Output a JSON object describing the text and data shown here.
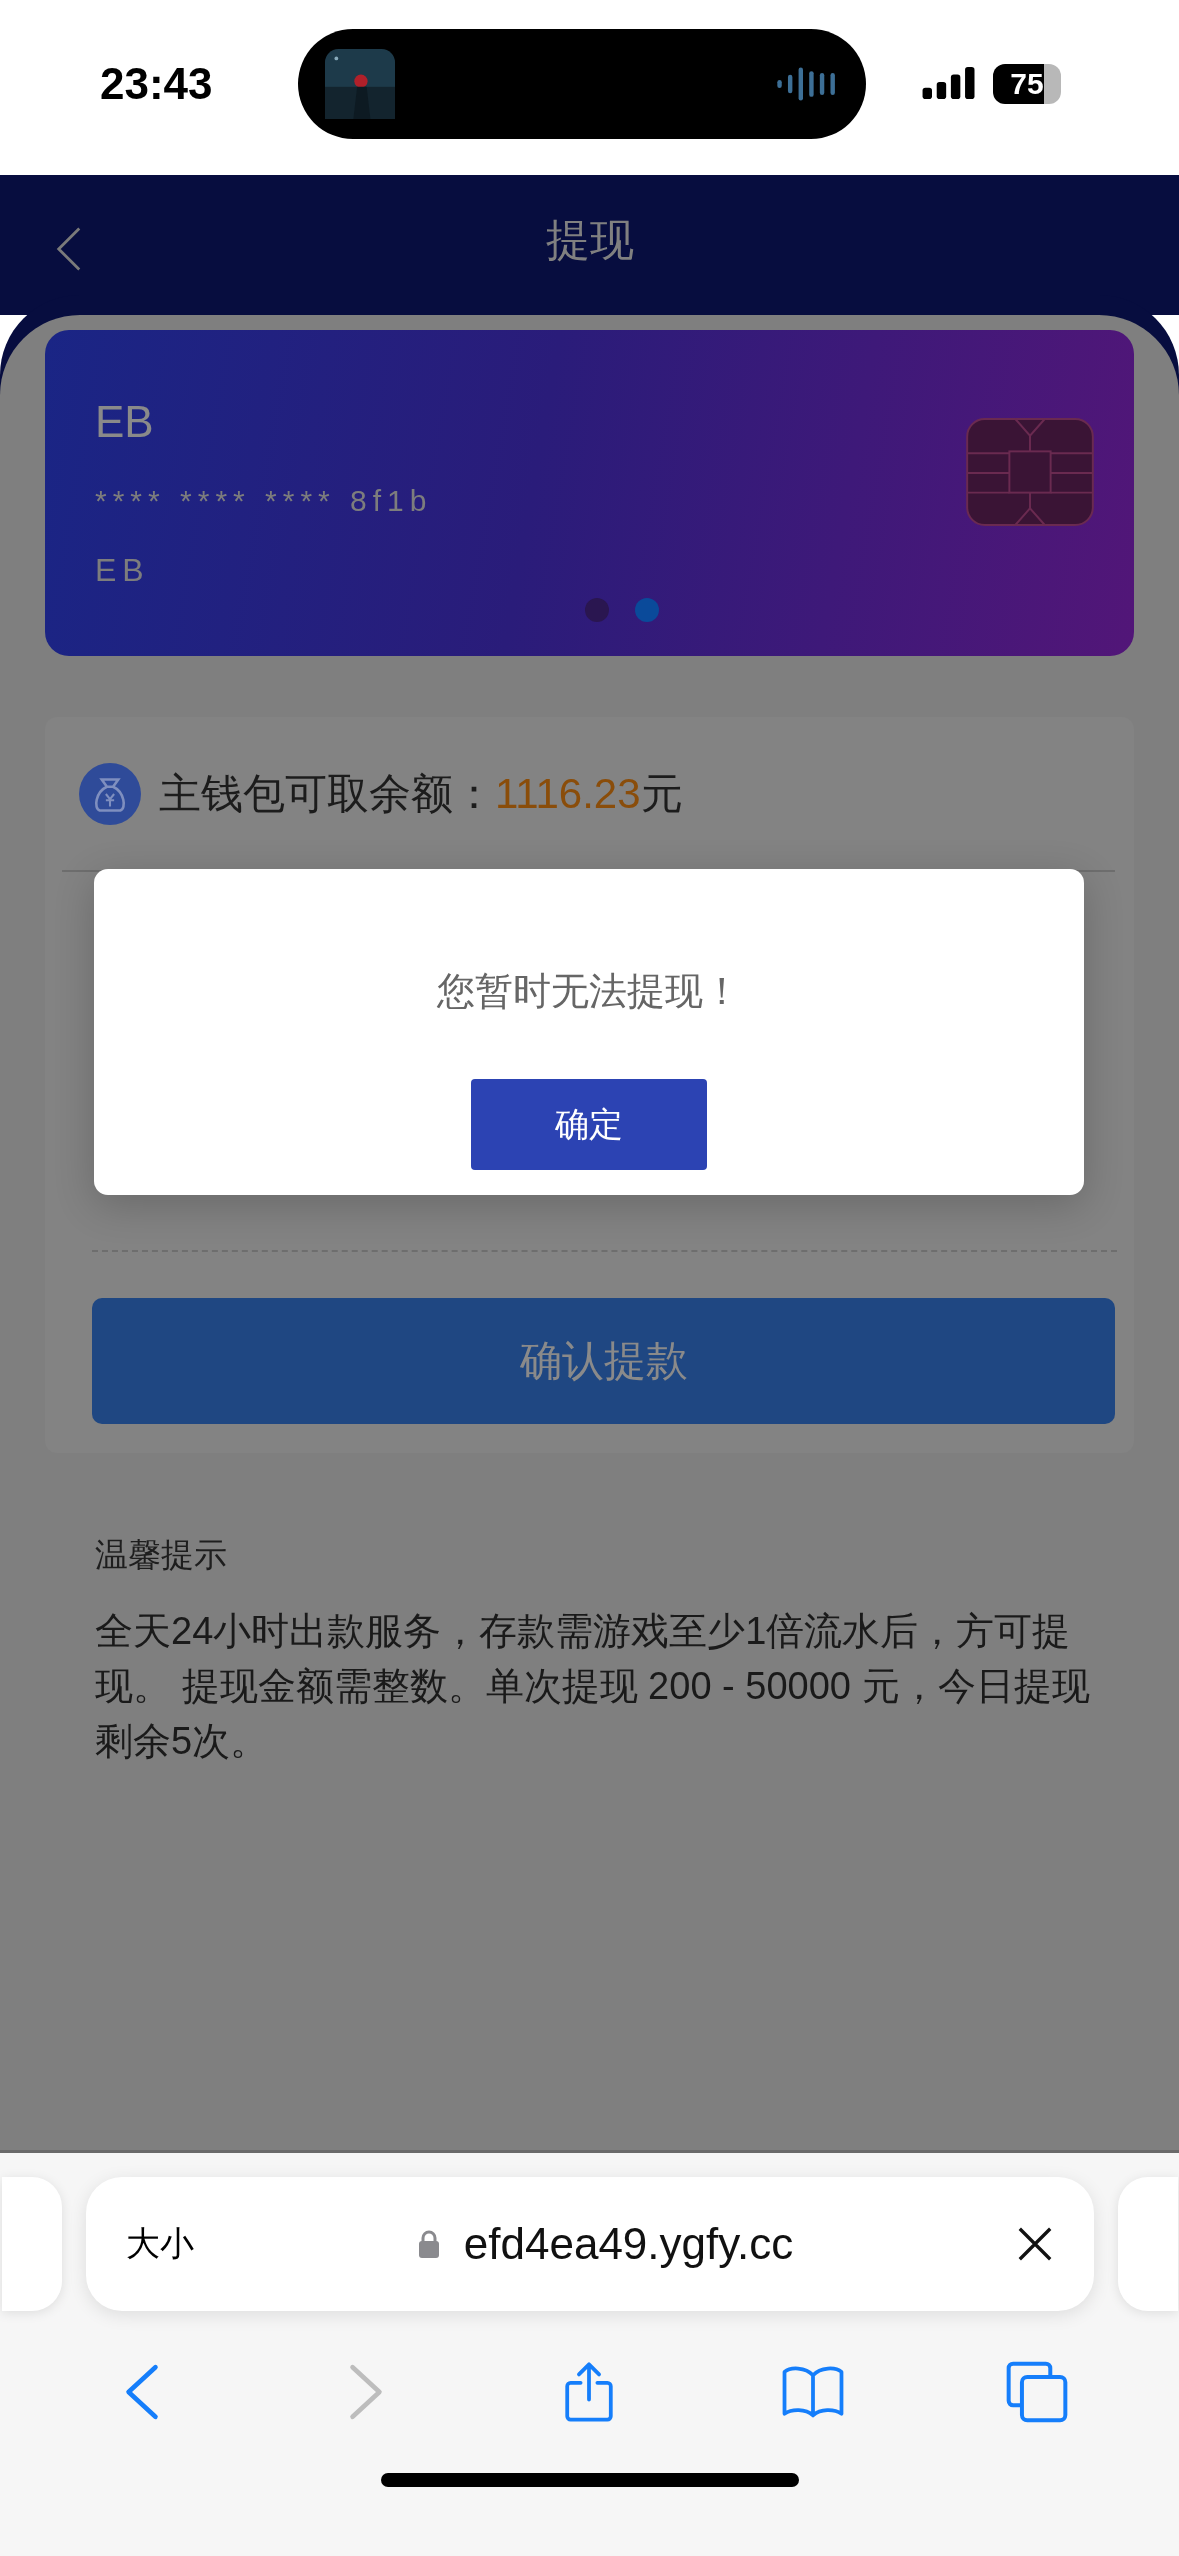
{
  "status_bar": {
    "time": "23:43",
    "battery": "75"
  },
  "header": {
    "title": "提现"
  },
  "card": {
    "bank": "EB",
    "number": "**** **** **** 8f1b",
    "holder": "EB",
    "dots": [
      {
        "selected": false
      },
      {
        "selected": true
      }
    ]
  },
  "balance": {
    "label": "主钱包可取余额：",
    "amount": "1116.23",
    "unit": "元"
  },
  "confirm_button": "确认提款",
  "tips": {
    "title": "温馨提示",
    "text": "全天24小时出款服务，存款需游戏至少1倍流水后，方可提现。 提现金额需整数。单次提现 200 - 50000 元，今日提现剩余5次。"
  },
  "dialog": {
    "message": "您暂时无法提现！",
    "button": "确定"
  },
  "browser": {
    "text_size": "大小",
    "url": "efd4ea49.ygfy.cc",
    "back_disabled": false,
    "forward_disabled": true
  }
}
